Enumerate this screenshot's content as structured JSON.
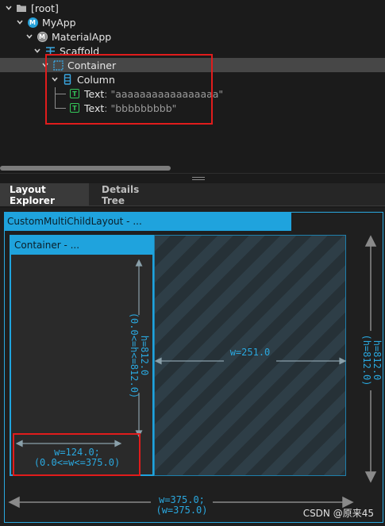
{
  "tree": {
    "nodes": [
      {
        "label": "[root]",
        "icon": "folder-icon"
      },
      {
        "label": "MyApp",
        "icon": "m-badge-icon"
      },
      {
        "label": "MaterialApp",
        "icon": "m-badge-icon"
      },
      {
        "label": "Scaffold",
        "icon": "scaffold-icon"
      },
      {
        "label": "Container",
        "icon": "container-icon",
        "selected": true
      },
      {
        "label": "Column",
        "icon": "column-icon"
      },
      {
        "label": "Text",
        "value": ": \"aaaaaaaaaaaaaaaaa\"",
        "icon": "text-icon"
      },
      {
        "label": "Text",
        "value": ": \"bbbbbbbbb\"",
        "icon": "text-icon"
      }
    ]
  },
  "tabs": [
    {
      "label": "Layout Explorer",
      "active": true
    },
    {
      "label": "Details Tree",
      "active": false
    }
  ],
  "explorer": {
    "outer_title": "CustomMultiChildLayout - ...",
    "child_title": "Container - ...",
    "child_height": "h=812.0",
    "child_height_constraint": "(0.0<=h<=812.0)",
    "child_width": "w=124.0;",
    "child_width_constraint": "(0.0<=w<=375.0)",
    "free_width": "w=251.0",
    "outer_height": "h=812.0",
    "outer_height_paren": "(h=812.0)",
    "outer_width": "w=375.0;",
    "outer_width_paren": "(w=375.0)"
  },
  "watermark": "CSDN @原来45",
  "colors": {
    "accent": "#1fa3dd",
    "highlight": "#e01c1c",
    "text_icon": "#34c759"
  }
}
